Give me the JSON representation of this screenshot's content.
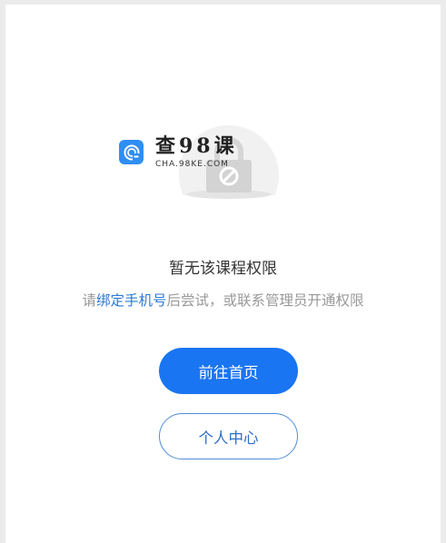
{
  "watermark": {
    "title": "查98课",
    "subtitle": "CHA.98KE.COM"
  },
  "main": {
    "title": "暂无该课程权限",
    "desc_prefix": "请",
    "desc_link": "绑定手机号",
    "desc_suffix": "后尝试，或联系管理员开通权限"
  },
  "buttons": {
    "home": "前往首页",
    "profile": "个人中心"
  },
  "colors": {
    "primary": "#1a75f2",
    "link": "#2e7ad6",
    "outline_text": "#2e6fc4"
  },
  "icons": {
    "watermark_logo": "search-logo-icon",
    "illustration": "lock-forbidden-icon"
  }
}
